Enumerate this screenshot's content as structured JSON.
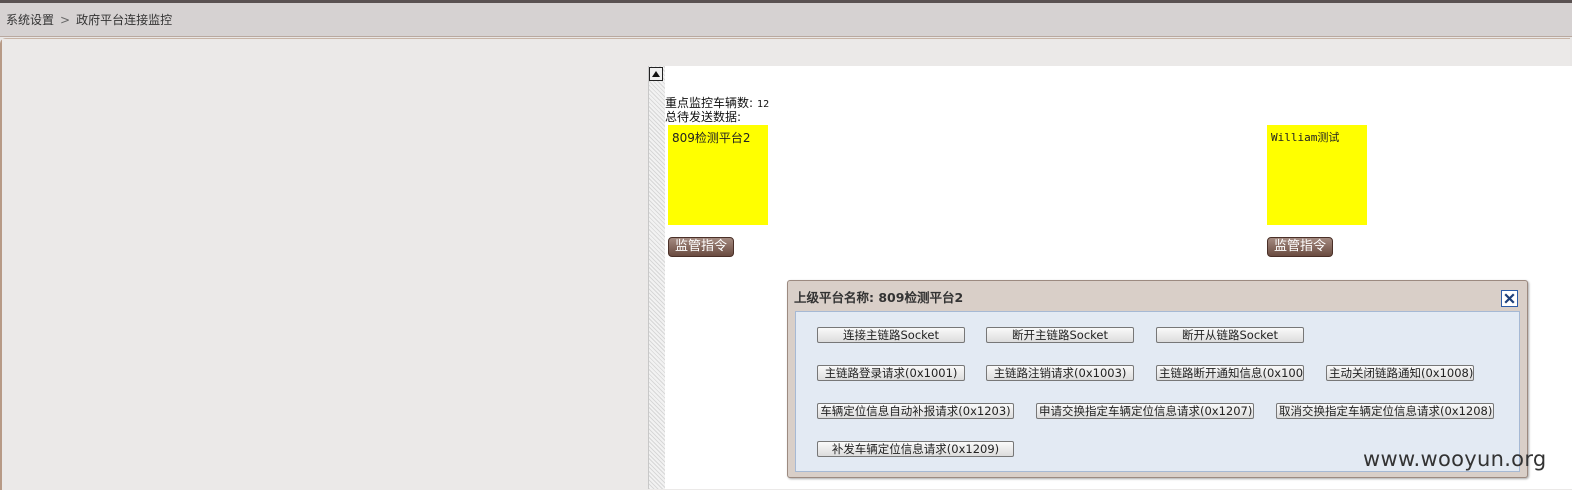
{
  "breadcrumb": {
    "items": [
      "系统设置",
      "政府平台连接监控"
    ],
    "separator": ">"
  },
  "stats": {
    "monitored_vehicles_label": "重点监控车辆数:",
    "monitored_vehicles_value": "12",
    "pending_data_label": "总待发送数据:"
  },
  "platforms": [
    {
      "name": "809检测平台2",
      "button_label": "监管指令"
    },
    {
      "name": "William测试",
      "button_label": "监管指令"
    }
  ],
  "dialog": {
    "title": "上级平台名称: 809检测平台2",
    "buttons": {
      "connect_main": "连接主链路Socket",
      "disconnect_main": "断开主链路Socket",
      "disconnect_sub": "断开从链路Socket",
      "main_login": "主链路登录请求(0x1001)",
      "main_logout": "主链路注销请求(0x1003)",
      "main_disconnect_notice": "主链路断开通知信息(0x100",
      "active_close_notice": "主动关闭链路通知(0x1008)",
      "auto_report": "车辆定位信息自动补报请求(0x1203)",
      "apply_exchange": "申请交换指定车辆定位信息请求(0x1207)",
      "cancel_exchange": "取消交换指定车辆定位信息请求(0x1208)",
      "resend": "补发车辆定位信息请求(0x1209)"
    }
  },
  "watermark": "www.wooyun.org",
  "colors": {
    "platform_box": "#ffff00",
    "dialog_body": "#e3eaf3",
    "command_button": "#6a4b40"
  },
  "icons": {
    "collapse": "triangle-up-icon",
    "close": "close-x-icon"
  }
}
